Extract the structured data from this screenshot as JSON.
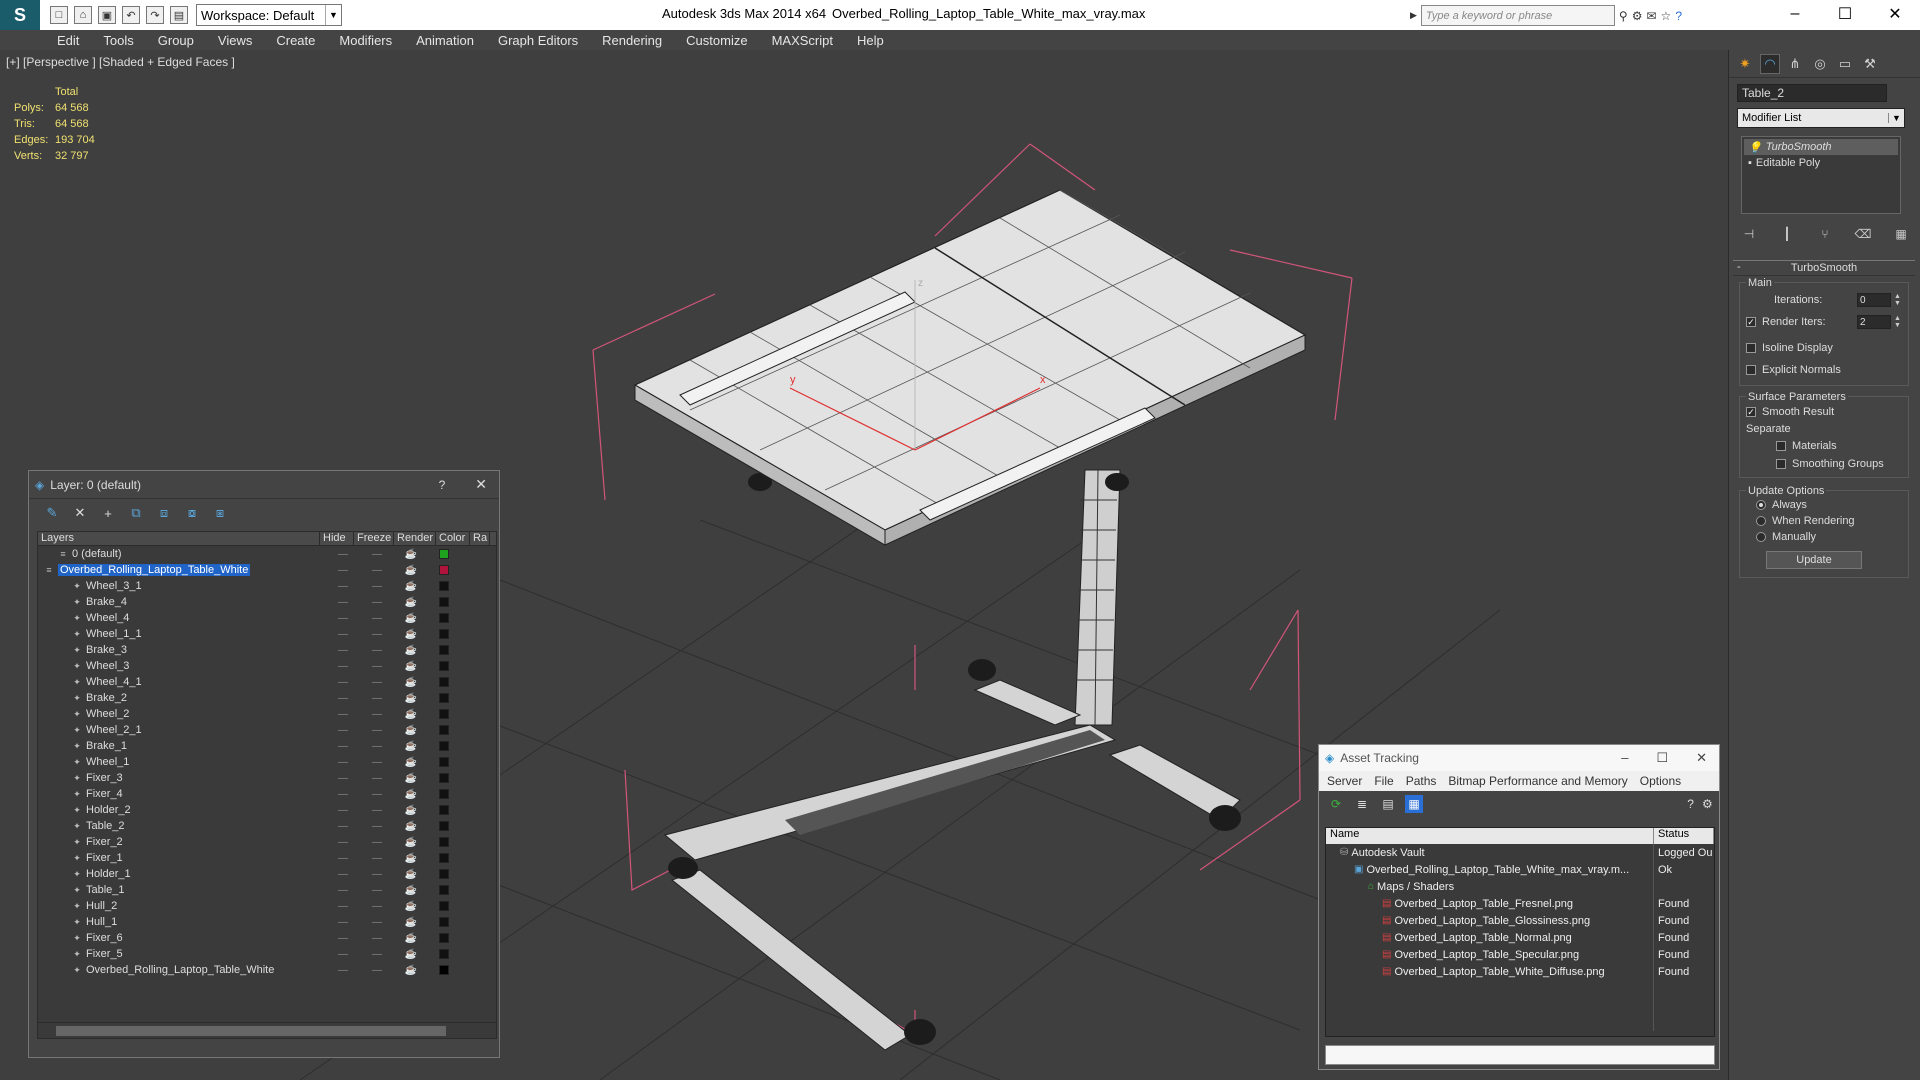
{
  "window": {
    "app_title": "Autodesk 3ds Max  2014 x64",
    "file_title": "Overbed_Rolling_Laptop_Table_White_max_vray.max",
    "workspace": "Workspace: Default",
    "search_placeholder": "Type a keyword or phrase"
  },
  "menu": [
    "Edit",
    "Tools",
    "Group",
    "Views",
    "Create",
    "Modifiers",
    "Animation",
    "Graph Editors",
    "Rendering",
    "Customize",
    "MAXScript",
    "Help"
  ],
  "viewport": {
    "label": "[+] [Perspective ] [Shaded + Edged Faces ]",
    "stats": {
      "header": "Total",
      "rows": [
        {
          "k": "Polys:",
          "v": "64 568"
        },
        {
          "k": "Tris:",
          "v": "64 568"
        },
        {
          "k": "Edges:",
          "v": "193 704"
        },
        {
          "k": "Verts:",
          "v": "32 797"
        }
      ]
    },
    "axis_y": "y",
    "axis_x": "x",
    "axis_z": "z"
  },
  "command_panel": {
    "object_name": "Table_2",
    "modifier_list": "Modifier List",
    "stack": [
      "TurboSmooth",
      "Editable Poly"
    ],
    "rollout_title": "TurboSmooth",
    "main_group": "Main",
    "iterations_label": "Iterations:",
    "iterations_value": "0",
    "render_iters_label": "Render Iters:",
    "render_iters_value": "2",
    "isoline_label": "Isoline Display",
    "explicit_normals_label": "Explicit Normals",
    "surface_params": "Surface Parameters",
    "smooth_result": "Smooth Result",
    "separate": "Separate",
    "materials": "Materials",
    "smoothing_groups": "Smoothing Groups",
    "update_options": "Update Options",
    "always": "Always",
    "when_rendering": "When Rendering",
    "manually": "Manually",
    "update_button": "Update"
  },
  "layer_window": {
    "title": "Layer: 0 (default)",
    "help": "?",
    "columns": [
      "Layers",
      "Hide",
      "Freeze",
      "Render",
      "Color",
      "Ra"
    ],
    "layers": [
      {
        "name": "0 (default)",
        "color": "#1fa31f",
        "indent": 1
      },
      {
        "name": "Overbed_Rolling_Laptop_Table_White",
        "color": "#b0143c",
        "indent": 0,
        "selected": true
      },
      {
        "name": "Wheel_3_1",
        "color": "#111111",
        "indent": 2
      },
      {
        "name": "Brake_4",
        "color": "#111111",
        "indent": 2
      },
      {
        "name": "Wheel_4",
        "color": "#111111",
        "indent": 2
      },
      {
        "name": "Wheel_1_1",
        "color": "#111111",
        "indent": 2
      },
      {
        "name": "Brake_3",
        "color": "#111111",
        "indent": 2
      },
      {
        "name": "Wheel_3",
        "color": "#111111",
        "indent": 2
      },
      {
        "name": "Wheel_4_1",
        "color": "#111111",
        "indent": 2
      },
      {
        "name": "Brake_2",
        "color": "#111111",
        "indent": 2
      },
      {
        "name": "Wheel_2",
        "color": "#111111",
        "indent": 2
      },
      {
        "name": "Wheel_2_1",
        "color": "#111111",
        "indent": 2
      },
      {
        "name": "Brake_1",
        "color": "#111111",
        "indent": 2
      },
      {
        "name": "Wheel_1",
        "color": "#111111",
        "indent": 2
      },
      {
        "name": "Fixer_3",
        "color": "#111111",
        "indent": 2
      },
      {
        "name": "Fixer_4",
        "color": "#111111",
        "indent": 2
      },
      {
        "name": "Holder_2",
        "color": "#111111",
        "indent": 2
      },
      {
        "name": "Table_2",
        "color": "#111111",
        "indent": 2
      },
      {
        "name": "Fixer_2",
        "color": "#111111",
        "indent": 2
      },
      {
        "name": "Fixer_1",
        "color": "#111111",
        "indent": 2
      },
      {
        "name": "Holder_1",
        "color": "#111111",
        "indent": 2
      },
      {
        "name": "Table_1",
        "color": "#111111",
        "indent": 2
      },
      {
        "name": "Hull_2",
        "color": "#111111",
        "indent": 2
      },
      {
        "name": "Hull_1",
        "color": "#111111",
        "indent": 2
      },
      {
        "name": "Fixer_6",
        "color": "#111111",
        "indent": 2
      },
      {
        "name": "Fixer_5",
        "color": "#111111",
        "indent": 2
      },
      {
        "name": "Overbed_Rolling_Laptop_Table_White",
        "color": "#000000",
        "indent": 2
      }
    ]
  },
  "asset_window": {
    "title": "Asset Tracking",
    "menu": [
      "Server",
      "File",
      "Paths",
      "Bitmap Performance and Memory",
      "Options"
    ],
    "columns": [
      "Name",
      "Status"
    ],
    "rows": [
      {
        "name": "Autodesk Vault",
        "status": "Logged Ou",
        "indent": 1,
        "icon": "vault"
      },
      {
        "name": "Overbed_Rolling_Laptop_Table_White_max_vray.m...",
        "status": "Ok",
        "indent": 2,
        "icon": "max"
      },
      {
        "name": "Maps / Shaders",
        "status": "",
        "indent": 3,
        "icon": "maps"
      },
      {
        "name": "Overbed_Laptop_Table_Fresnel.png",
        "status": "Found",
        "indent": 4,
        "icon": "png"
      },
      {
        "name": "Overbed_Laptop_Table_Glossiness.png",
        "status": "Found",
        "indent": 4,
        "icon": "png"
      },
      {
        "name": "Overbed_Laptop_Table_Normal.png",
        "status": "Found",
        "indent": 4,
        "icon": "png"
      },
      {
        "name": "Overbed_Laptop_Table_Specular.png",
        "status": "Found",
        "indent": 4,
        "icon": "png"
      },
      {
        "name": "Overbed_Laptop_Table_White_Diffuse.png",
        "status": "Found",
        "indent": 4,
        "icon": "png"
      }
    ]
  }
}
